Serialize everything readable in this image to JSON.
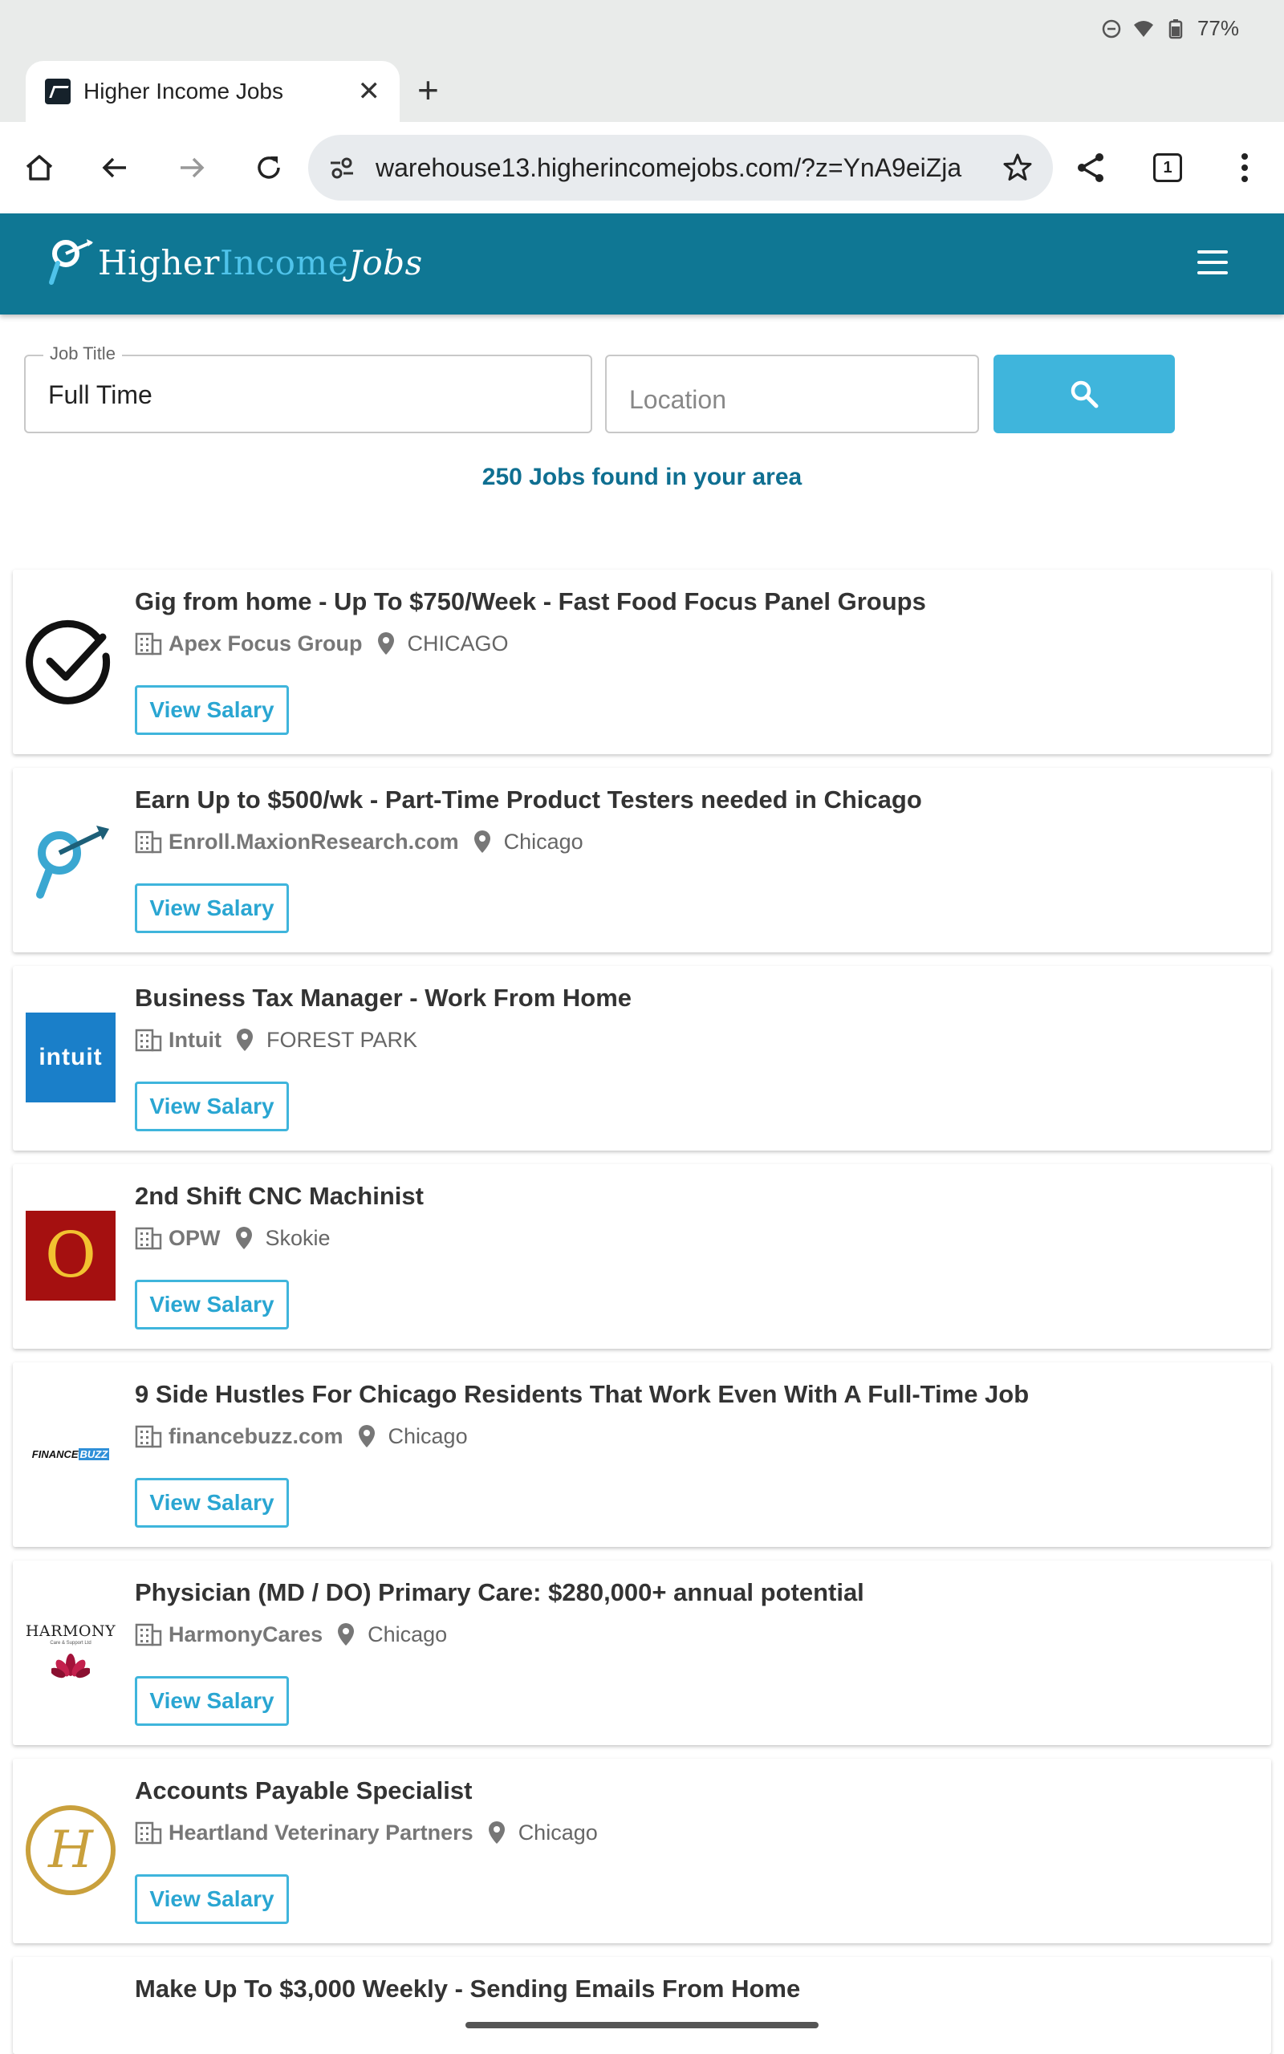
{
  "status_bar": {
    "battery": "77%"
  },
  "browser": {
    "tab_title": "Higher Income Jobs",
    "url": "warehouse13.higherincomejobs.com/?z=YnA9eiZja",
    "tab_count": "1"
  },
  "site": {
    "logo": {
      "part1": "Higher",
      "part2": "Income",
      "part3": "Jobs"
    }
  },
  "search": {
    "job_title_label": "Job Title",
    "job_title_value": "Full Time",
    "location_placeholder": "Location"
  },
  "results_count": "250 Jobs found in your area",
  "jobs": [
    {
      "title": "Gig from home - Up To $750/Week - Fast Food Focus Panel Groups",
      "company": "Apex Focus Group",
      "location": "CHICAGO",
      "button": "View Salary",
      "logo": "checkmark-circle"
    },
    {
      "title": "Earn Up to $500/wk - Part-Time Product Testers needed in Chicago",
      "company": "Enroll.MaxionResearch.com",
      "location": "Chicago",
      "button": "View Salary",
      "logo": "magnifier-arrow"
    },
    {
      "title": "Business Tax Manager - Work From Home",
      "company": "Intuit",
      "location": "FOREST PARK",
      "button": "View Salary",
      "logo": "intuit",
      "logo_text": "intuit"
    },
    {
      "title": "2nd Shift CNC Machinist",
      "company": "OPW",
      "location": "Skokie",
      "button": "View Salary",
      "logo": "opw",
      "logo_text": "O"
    },
    {
      "title": "9 Side Hustles For Chicago Residents That Work Even With A Full-Time Job",
      "company": "financebuzz.com",
      "location": "Chicago",
      "button": "View Salary",
      "logo": "financebuzz",
      "logo_text_1": "FINANCE",
      "logo_text_2": "BUZZ"
    },
    {
      "title": "Physician (MD / DO) Primary Care: $280,000+ annual potential",
      "company": "HarmonyCares",
      "location": "Chicago",
      "button": "View Salary",
      "logo": "harmony",
      "logo_text": "HARMONY",
      "logo_subtext": "Care & Support Ltd"
    },
    {
      "title": "Accounts Payable Specialist",
      "company": "Heartland Veterinary Partners",
      "location": "Chicago",
      "button": "View Salary",
      "logo": "h-circle",
      "logo_text": "H"
    },
    {
      "title": "Make Up To $3,000 Weekly - Sending Emails From Home"
    }
  ],
  "colors": {
    "header": "#0f7794",
    "accent": "#3fb5dc",
    "link": "#0f6f91"
  }
}
